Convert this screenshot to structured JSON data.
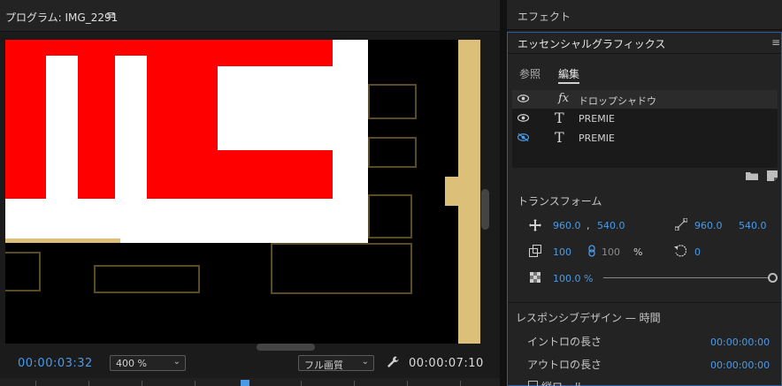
{
  "program": {
    "title": "プログラム: IMG_2291",
    "menu_icon": "hamburger-icon",
    "timecode_current": "00:00:03:32",
    "timecode_duration": "00:00:07:10",
    "zoom": "400 %",
    "quality": "フル画質"
  },
  "effects": {
    "title": "エフェクト"
  },
  "essential_graphics": {
    "title": "エッセンシャルグラフィックス",
    "tabs": [
      "参照",
      "編集"
    ],
    "active_tab": "編集",
    "layers": [
      {
        "type": "fx",
        "name": "ドロップシャドウ",
        "visible": true
      },
      {
        "type": "text",
        "name": "PREMIE",
        "visible": true
      },
      {
        "type": "text",
        "name": "PREMIE",
        "visible": false
      }
    ],
    "transform": {
      "title": "トランスフォーム",
      "position_x": "960.0",
      "position_sep": ",",
      "position_y": "540.0",
      "anchor_x": "960.0",
      "anchor_y": "540.0",
      "scale": "100",
      "scale_width": "100",
      "scale_unit": "%",
      "rotation": "0",
      "opacity": "100.0 %"
    },
    "responsive": {
      "title": "レスポンシブデザイン — 時間",
      "intro_label": "イントロの長さ",
      "intro_value": "00:00:00:00",
      "outro_label": "アウトロの長さ",
      "outro_value": "00:00:00:00",
      "roll_label": "縦ロール"
    }
  },
  "colors": {
    "accent": "#4a9ae8",
    "canvas_bg": "#dcc07a",
    "title_red": "#ff0000"
  }
}
